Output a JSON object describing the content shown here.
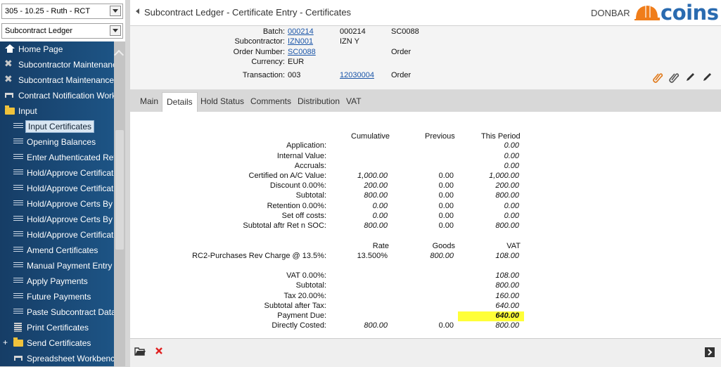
{
  "sidebar": {
    "combo1": "305 - 10.25 - Ruth - RCT",
    "combo2": "Subcontract Ledger",
    "items": [
      {
        "label": "Home Page",
        "icon": "home-icon"
      },
      {
        "label": "Subcontractor Maintenance",
        "icon": "tools-icon"
      },
      {
        "label": "Subcontract Maintenance",
        "icon": "tools-icon"
      },
      {
        "label": "Contract Notification Workbench",
        "icon": "workbench-icon"
      },
      {
        "label": "Input",
        "icon": "folder-icon"
      },
      {
        "label": "Input Certificates",
        "icon": "list-icon"
      },
      {
        "label": "Opening Balances",
        "icon": "list-icon"
      },
      {
        "label": "Enter Authenticated Returns",
        "icon": "list-icon"
      },
      {
        "label": "Hold/Approve Certificates",
        "icon": "list-icon"
      },
      {
        "label": "Hold/Approve Certificates",
        "icon": "list-icon"
      },
      {
        "label": "Hold/Approve Certs By",
        "icon": "list-icon"
      },
      {
        "label": "Hold/Approve Certs By",
        "icon": "list-icon"
      },
      {
        "label": "Hold/Approve Certificates",
        "icon": "list-icon"
      },
      {
        "label": "Amend Certificates",
        "icon": "list-icon"
      },
      {
        "label": "Manual Payment Entry",
        "icon": "list-icon"
      },
      {
        "label": "Apply Payments",
        "icon": "list-icon"
      },
      {
        "label": "Future Payments",
        "icon": "list-icon"
      },
      {
        "label": "Paste Subcontract Data",
        "icon": "list-icon"
      },
      {
        "label": "Print Certificates",
        "icon": "print-icon"
      },
      {
        "label": "Send Certificates",
        "icon": "folder-icon"
      },
      {
        "label": "Spreadsheet Workbench",
        "icon": "workbench-icon"
      }
    ]
  },
  "title_bar": {
    "title": "Subcontract Ledger - Certificate Entry - Certificates",
    "company": "DONBAR",
    "logo_text": "coins"
  },
  "header": {
    "batch_label": "Batch:",
    "batch_link": "000214",
    "batch_value": "000214",
    "batch_code": "SC0088",
    "subcontractor_label": "Subcontractor:",
    "subcontractor_link": "IZN001",
    "subcontractor_value": "IZN Y",
    "order_label": "Order Number:",
    "order_link": "SC0088",
    "order_type": "Order",
    "currency_label": "Currency:",
    "currency_value": "EUR",
    "transaction_label": "Transaction:",
    "transaction_value": "003",
    "transaction_link": "12030004",
    "transaction_type": "Order"
  },
  "tabs": [
    "Main",
    "Details",
    "Hold Status",
    "Comments",
    "Distribution",
    "VAT"
  ],
  "details": {
    "col_headers": [
      "Cumulative",
      "Previous",
      "This Period"
    ],
    "rows": [
      {
        "label": "Application:",
        "cum": "",
        "prev": "",
        "this": "0.00"
      },
      {
        "label": "Internal Value:",
        "cum": "",
        "prev": "",
        "this": "0.00"
      },
      {
        "label": "Accruals:",
        "cum": "",
        "prev": "",
        "this": "0.00"
      },
      {
        "label": "Certified on A/C Value:",
        "cum": "1,000.00",
        "prev": "0.00",
        "this": "1,000.00"
      },
      {
        "label": "Discount 0.00%:",
        "cum": "200.00",
        "prev": "0.00",
        "this": "200.00"
      },
      {
        "label": "Subtotal:",
        "cum": "800.00",
        "prev": "0.00",
        "this": "800.00"
      },
      {
        "label": "Retention 0.00%:",
        "cum": "0.00",
        "prev": "0.00",
        "this": "0.00"
      },
      {
        "label": "Set off costs:",
        "cum": "0.00",
        "prev": "0.00",
        "this": "0.00"
      },
      {
        "label": "Subtotal aftr Ret n SOC:",
        "cum": "800.00",
        "prev": "0.00",
        "this": "800.00"
      }
    ],
    "vat_headers": [
      "Rate",
      "Goods",
      "VAT"
    ],
    "vat_row": {
      "label": "RC2-Purchases Rev Charge @ 13.5%:",
      "rate": "13.500%",
      "goods": "800.00",
      "vat": "108.00"
    },
    "summary": [
      {
        "label": "VAT 0.00%:",
        "cum": "",
        "prev": "",
        "this": "108.00"
      },
      {
        "label": "Subtotal:",
        "cum": "",
        "prev": "",
        "this": "800.00"
      },
      {
        "label": "Tax 20.00%:",
        "cum": "",
        "prev": "",
        "this": "160.00"
      },
      {
        "label": "Subtotal after Tax:",
        "cum": "",
        "prev": "",
        "this": "640.00"
      },
      {
        "label": "Payment Due:",
        "cum": "",
        "prev": "",
        "this": "640.00"
      },
      {
        "label": "Directly Costed:",
        "cum": "800.00",
        "prev": "0.00",
        "this": "800.00"
      }
    ]
  },
  "colors": {
    "nav_bg": "#1d5485",
    "highlight": "#ffff38",
    "link": "#1a55a8",
    "logo_orange": "#f07d1a"
  }
}
